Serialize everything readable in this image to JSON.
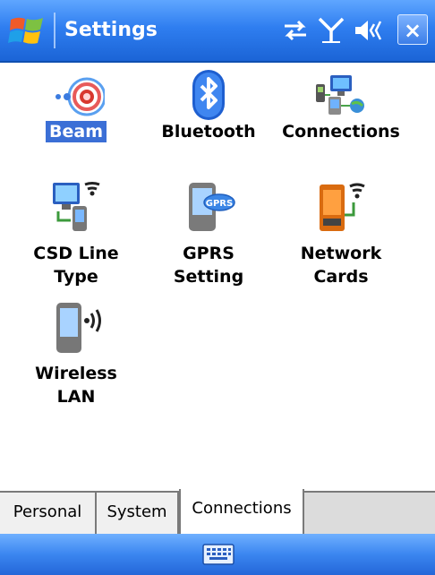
{
  "titlebar": {
    "title": "Settings",
    "start_icon": "windows-flag-icon",
    "tray": [
      "connectivity-icon",
      "signal-icon",
      "volume-icon"
    ],
    "close_label": "×"
  },
  "items": [
    {
      "label": "Beam",
      "icon": "beam-icon",
      "selected": true
    },
    {
      "label": "Bluetooth",
      "icon": "bluetooth-icon",
      "selected": false
    },
    {
      "label": "Connections",
      "icon": "connections-icon",
      "selected": false
    },
    {
      "label_line1": "CSD Line",
      "label_line2": "Type",
      "icon": "csd-line-type-icon"
    },
    {
      "label_line1": "GPRS",
      "label_line2": "Setting",
      "icon": "gprs-icon",
      "badge": "GPRS"
    },
    {
      "label_line1": "Network",
      "label_line2": "Cards",
      "icon": "network-cards-icon"
    },
    {
      "label_line1": "Wireless",
      "label_line2": "LAN",
      "icon": "wireless-lan-icon"
    }
  ],
  "tabs": [
    {
      "label": "Personal",
      "active": false
    },
    {
      "label": "System",
      "active": false
    },
    {
      "label": "Connections",
      "active": true
    }
  ],
  "bottombar": {
    "input_icon": "keyboard-icon"
  },
  "colors": {
    "titlebar": "#2f7ef0",
    "selection": "#3b6fd6",
    "bottombar": "#3b86f0"
  }
}
